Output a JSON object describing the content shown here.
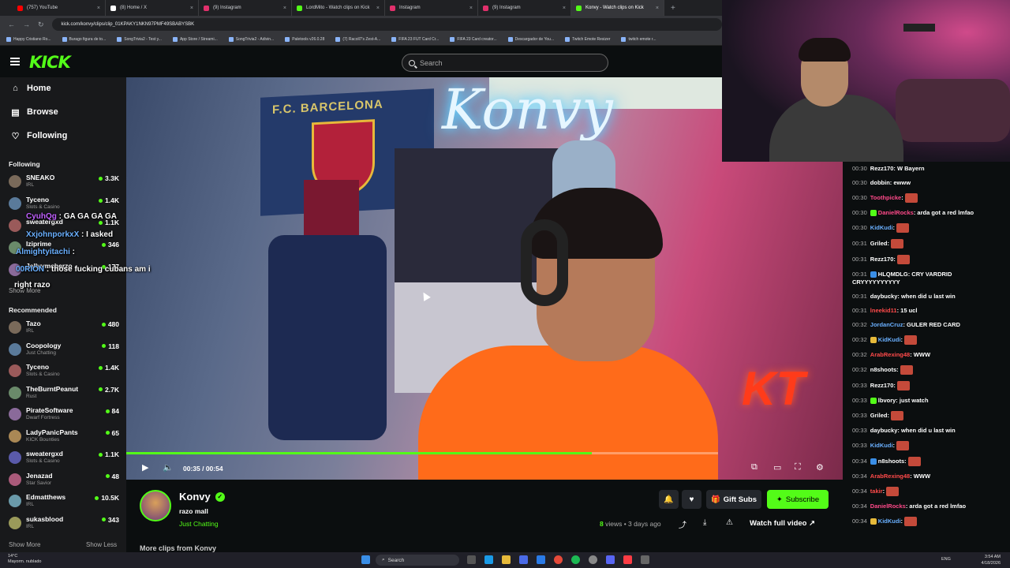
{
  "browser": {
    "tabs": [
      {
        "label": "(757) YouTube",
        "color": "#ff0000"
      },
      {
        "label": "(8) Home / X",
        "color": "#ffffff"
      },
      {
        "label": "(9) Instagram",
        "color": "#e1306c"
      },
      {
        "label": "LordMito - Watch clips on Kick",
        "color": "#53fc18"
      },
      {
        "label": "Instagram",
        "color": "#e1306c"
      },
      {
        "label": "(9) Instagram",
        "color": "#e1306c"
      },
      {
        "label": "Konvy - Watch clips on Kick",
        "color": "#53fc18",
        "active": true
      }
    ],
    "url": "kick.com/konvy/clips/clip_01KPAKY1NKN97PMF49SBABYSBK",
    "bookmarks": [
      "Happy Cristiano Ro...",
      "Burago figura de to...",
      "SongTrivia2 - Test y...",
      "App Store / Streami...",
      "SongTrivia2 - Adivin...",
      "Paletools v26.0.28",
      "(7) Racoll7's Zest-A...",
      "FIFA 23 FUT Card Cr...",
      "FIFA 23 Card creator...",
      "Descargador de You...",
      "Twitch Emote Resizer",
      "twitch emote r..."
    ]
  },
  "kick": {
    "logo": "KICK",
    "search_placeholder": "Search"
  },
  "sidebar": {
    "nav": [
      {
        "label": "Home",
        "icon": "home-icon",
        "glyph": "⌂"
      },
      {
        "label": "Browse",
        "icon": "browse-icon",
        "glyph": "▤"
      },
      {
        "label": "Following",
        "icon": "heart-icon",
        "glyph": "♡"
      }
    ],
    "following_title": "Following",
    "following": [
      {
        "name": "SNEAKO",
        "category": "IRL",
        "viewers": "3.3K"
      },
      {
        "name": "Tyceno",
        "category": "Slots & Casino",
        "viewers": "1.4K"
      },
      {
        "name": "sweatergxd",
        "category": "",
        "viewers": "1.1K"
      },
      {
        "name": "Iziprime",
        "category": "",
        "viewers": "346"
      },
      {
        "name": "Jellyymcherzo",
        "category": "",
        "viewers": "177"
      }
    ],
    "show_more_following": "Show More",
    "recommended_title": "Recommended",
    "recommended": [
      {
        "name": "Tazo",
        "category": "IRL",
        "viewers": "480"
      },
      {
        "name": "Coopology",
        "category": "Just Chatting",
        "viewers": "118"
      },
      {
        "name": "Tyceno",
        "category": "Slots & Casino",
        "viewers": "1.4K"
      },
      {
        "name": "TheBurntPeanut",
        "category": "Rust",
        "viewers": "2.7K"
      },
      {
        "name": "PirateSoftware",
        "category": "Dwarf Fortress",
        "viewers": "84"
      },
      {
        "name": "LadyPanicPants",
        "category": "KICK Bounties",
        "viewers": "65"
      },
      {
        "name": "sweatergxd",
        "category": "Slots & Casino",
        "viewers": "1.1K"
      },
      {
        "name": "Jenazad",
        "category": "Star Savior",
        "viewers": "48"
      },
      {
        "name": "Edmatthews",
        "category": "IRL",
        "viewers": "10.5K"
      },
      {
        "name": "sukasblood",
        "category": "IRL",
        "viewers": "343"
      }
    ],
    "show_more": "Show More",
    "show_less": "Show Less"
  },
  "overlay_chat": [
    {
      "user": "CyuhQg",
      "text": " : GA  GA  GA  GA",
      "color": "#c060ff"
    },
    {
      "user": "XxjohnporkxX",
      "text": " : I asked",
      "color": "#6ab0ff"
    },
    {
      "user": "Almightyitachi",
      "text": " : ",
      "color": "#6ab0ff"
    },
    {
      "user": "00RION",
      "text": " : those fucking cubans am i",
      "color": "#6ab0ff"
    },
    {
      "user": "",
      "text": "right razo",
      "color": "#ffffff"
    }
  ],
  "video": {
    "time": "00:35 / 00:54",
    "progress": 0.787,
    "neon_text": "Konvy",
    "flag_text": "F.C. BARCELONA",
    "sign_text": "KT"
  },
  "clip": {
    "channel": "Konvy",
    "title": "razo mall",
    "category": "Just Chatting",
    "views": "8",
    "views_suffix": " views",
    "age": " • 3 days ago",
    "gift_label": "Gift Subs",
    "subscribe_label": "Subscribe",
    "watch_full": "Watch full video",
    "more_clips": "More clips from Konvy"
  },
  "chat": [
    {
      "time": "00:30",
      "user": "Rezz170",
      "color": "#ffffff",
      "text": ": W Bayern"
    },
    {
      "time": "00:30",
      "user": "dobbin",
      "color": "#ffffff",
      "text": ": ewww"
    },
    {
      "time": "00:30",
      "user": "Toothpicke",
      "color": "#ff4a8a",
      "text": ": ",
      "emote": true
    },
    {
      "time": "00:30",
      "user": "DanielRocks",
      "color": "#ff4a8a",
      "text": ": arda got a red lmfao"
    },
    {
      "time": "00:30",
      "user": "KidKudi",
      "color": "#6ab0ff",
      "text": ": ",
      "emote": true
    },
    {
      "time": "00:31",
      "user": "Griled",
      "color": "#ffffff",
      "text": ": ",
      "emote": true
    },
    {
      "time": "00:31",
      "user": "Rezz170",
      "color": "#ffffff",
      "text": ": ",
      "emote": true
    },
    {
      "time": "00:31",
      "user": "HLQMDLG",
      "color": "#ffffff",
      "text": ": CRY VARDRID CRYYYYYYYYYY"
    },
    {
      "time": "00:31",
      "user": "daybucky",
      "color": "#ffffff",
      "text": ": when did u last win"
    },
    {
      "time": "00:31",
      "user": "lneekid11",
      "color": "#ff4a4a",
      "text": ": 15 ucl"
    },
    {
      "time": "00:32",
      "user": "JordanCruz",
      "color": "#6ab0ff",
      "text": ": GULER RED CARD"
    },
    {
      "time": "00:32",
      "user": "KidKudi",
      "color": "#6ab0ff",
      "text": ": ",
      "emote": true
    },
    {
      "time": "00:32",
      "user": "ArabRexing48",
      "color": "#ff4a4a",
      "text": ": WWW"
    },
    {
      "time": "00:32",
      "user": "n8shoots",
      "color": "#ffffff",
      "text": ": ",
      "emote": true
    },
    {
      "time": "00:33",
      "user": "Rezz170",
      "color": "#ffffff",
      "text": ": ",
      "emote": true
    },
    {
      "time": "00:33",
      "user": "lbvory",
      "color": "#ffffff",
      "text": ": just watch"
    },
    {
      "time": "00:33",
      "user": "Griled",
      "color": "#ffffff",
      "text": ": ",
      "emote": true
    },
    {
      "time": "00:33",
      "user": "daybucky",
      "color": "#ffffff",
      "text": ": when did u last win"
    },
    {
      "time": "00:33",
      "user": "KidKudi",
      "color": "#6ab0ff",
      "text": ": ",
      "emote": true
    },
    {
      "time": "00:34",
      "user": "n8shoots",
      "color": "#ffffff",
      "text": ": ",
      "emote": true
    },
    {
      "time": "00:34",
      "user": "ArabRexing48",
      "color": "#ff4a4a",
      "text": ": WWW"
    },
    {
      "time": "00:34",
      "user": "takir",
      "color": "#ff4a4a",
      "text": ": ",
      "emote": true
    },
    {
      "time": "00:34",
      "user": "DanielRocks",
      "color": "#ff4a8a",
      "text": ": arda got a red lmfao"
    },
    {
      "time": "00:34",
      "user": "KidKudi",
      "color": "#6ab0ff",
      "text": ": ",
      "emote": true
    }
  ],
  "taskbar": {
    "weather_temp": "14°C",
    "weather_desc": "Mayorm. nublado",
    "search": "Search",
    "lang": "ENG",
    "time": "3:54 AM",
    "date": "4/18/2026"
  }
}
